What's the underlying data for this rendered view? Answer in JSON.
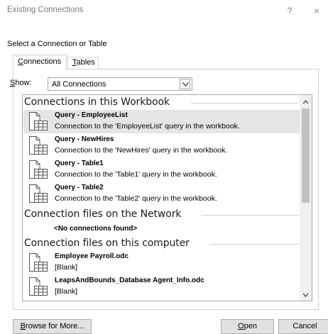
{
  "window": {
    "title": "Existing Connections",
    "help_label": "?",
    "close_label": "×"
  },
  "subtitle": "Select a Connection or Table",
  "tabs": [
    {
      "prefix": "",
      "hotkey": "C",
      "rest": "onnections",
      "active": true
    },
    {
      "prefix": "",
      "hotkey": "T",
      "rest": "ables",
      "active": false
    }
  ],
  "show": {
    "label_hotkey": "S",
    "label_rest": "how:",
    "selected": "All Connections"
  },
  "sections": [
    {
      "header": "Connections in this Workbook",
      "items": [
        {
          "name": "Query - EmployeeList",
          "desc": "Connection to the 'EmployeeList' query in the workbook.",
          "selected": true
        },
        {
          "name": "Query - NewHires",
          "desc": "Connection to the 'NewHires' query in the workbook.",
          "selected": false
        },
        {
          "name": "Query - Table1",
          "desc": "Connection to the 'Table1' query in the workbook.",
          "selected": false
        },
        {
          "name": "Query - Table2",
          "desc": "Connection to the 'Table2' query in the workbook.",
          "selected": false
        }
      ]
    },
    {
      "header": "Connection files on the Network",
      "empty_text": "<No connections found>"
    },
    {
      "header": "Connection files on this computer",
      "items": [
        {
          "name": "Employee Payroll.odc",
          "desc": "[Blank]",
          "selected": false
        },
        {
          "name": "LeapsAndBounds_Database Agent_Info.odc",
          "desc": "[Blank]",
          "selected": false
        }
      ]
    }
  ],
  "footer": {
    "browse_hotkey": "B",
    "browse_rest": "rowse for More...",
    "open_hotkey": "O",
    "open_rest": "pen",
    "cancel_label": "Cancel"
  }
}
